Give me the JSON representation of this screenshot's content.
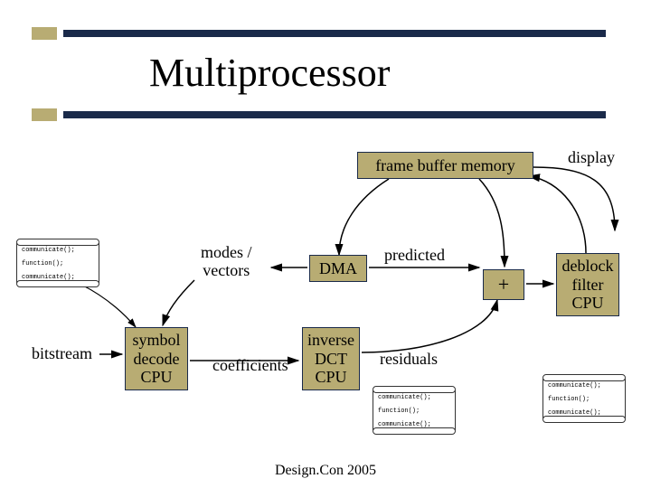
{
  "title": "Multiprocessor",
  "blocks": {
    "frame_buffer": "frame buffer memory",
    "dma": "DMA",
    "symbol_decode": "symbol\ndecode\nCPU",
    "inverse_dct": "inverse\nDCT\nCPU",
    "deblock": "deblock\nfilter\nCPU",
    "plus": "+"
  },
  "labels": {
    "display": "display",
    "modes_vectors": "modes /\nvectors",
    "predicted": "predicted",
    "bitstream": "bitstream",
    "coefficients": "coefficients",
    "residuals": "residuals"
  },
  "scroll": {
    "l1": "communicate();",
    "l2": "function();",
    "l3": "communicate();"
  },
  "footer": "Design.Con 2005"
}
